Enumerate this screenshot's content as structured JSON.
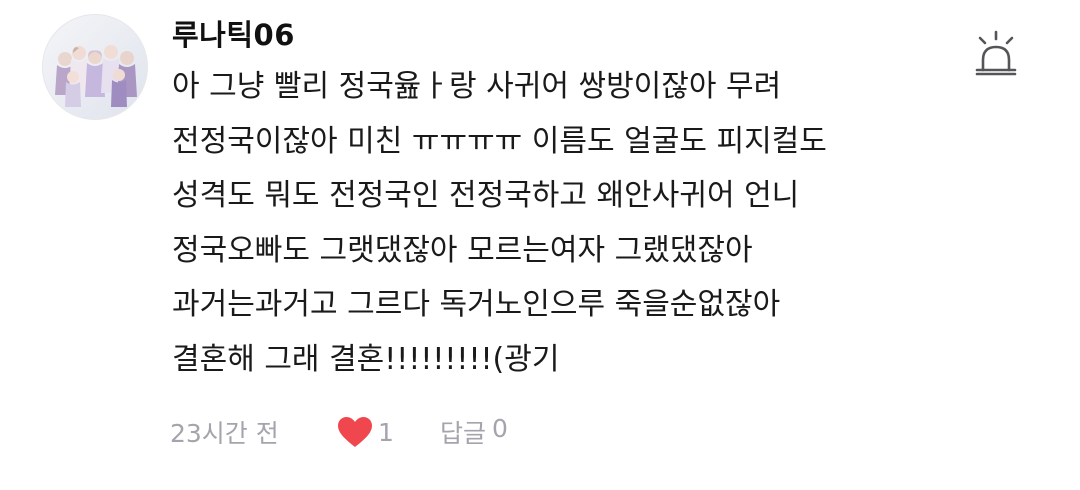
{
  "comment": {
    "username": "루나틱06",
    "avatar_icon": "group-photo-avatar",
    "report_icon": "siren-icon",
    "lines": [
      "아 그냥 빨리 정국윮ㅏ랑 사귀어 쌍방이잖아 무려",
      "전정국이잖아 미친 ㅠㅠㅠㅠ 이름도 얼굴도 피지컬도",
      "성격도 뭐도 전정국인 전정국하고 왜안사귀어 언니",
      "정국오빠도 그랫댔잖아 모르는여자 그랬댔잖아",
      "과거는과거고 그르다 독거노인으루 죽을순없잖아",
      "결혼해 그래 결혼!!!!!!!!!(광기"
    ],
    "time": "23시간 전",
    "like_icon": "heart-icon",
    "like_color": "#f0474f",
    "like_count": "1",
    "reply_label": "답글",
    "reply_count": "0"
  }
}
